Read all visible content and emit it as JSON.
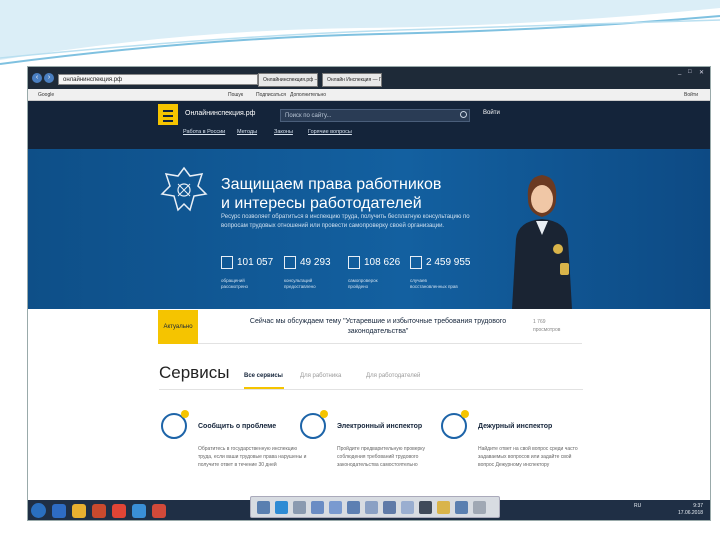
{
  "browser": {
    "address": "онлайнинспекция.рф",
    "tabs": [
      "Онлайнинспекция.рф — ...",
      "Онлайн Инспекция — Го..."
    ],
    "controls": {
      "min": "_",
      "max": "□",
      "close": "✕"
    },
    "bookmarks": {
      "search_engine": "Google",
      "items": [
        "Пошук",
        "Подписаться",
        "Дополнительно"
      ],
      "right": "Войти"
    }
  },
  "site": {
    "logo": "Онлайнинспекция.рф",
    "search_placeholder": "Поиск по сайту...",
    "login": "Войти",
    "subnav": [
      "Работа в России",
      "Методы",
      "Законы",
      "Горячие вопросы"
    ]
  },
  "hero": {
    "title_line1": "Защищаем права работников",
    "title_line2": "и интересы работодателей",
    "description": "Ресурс позволяет обратиться в инспекцию труда, получить бесплатную консультацию по вопросам трудовых отношений или провести самопроверку своей организации.",
    "stats": [
      {
        "icon": "mail-icon",
        "number": "101 057",
        "label1": "обращений",
        "label2": "рассмотрено"
      },
      {
        "icon": "calendar-icon",
        "number": "49 293",
        "label1": "консультаций",
        "label2": "предоставлено"
      },
      {
        "icon": "document-icon",
        "number": "108 626",
        "label1": "самопроверок",
        "label2": "пройдено"
      },
      {
        "icon": "gavel-icon",
        "number": "2 459 955",
        "label1": "случаев",
        "label2": "восстановленных прав"
      }
    ]
  },
  "actual": {
    "tag": "Актуально",
    "text": "Сейчас мы обсуждаем тему \"Устаревшие и избыточные требования трудового законодательства\"",
    "views": "1 769",
    "views_label": "просмотров"
  },
  "services": {
    "title": "Сервисы",
    "tabs": [
      "Все сервисы",
      "Для работника",
      "Для работодателей"
    ],
    "cards": [
      {
        "icon": "envelope-icon",
        "title": "Сообщить о проблеме",
        "desc": "Обратитесь в государственную инспекцию труда, если ваши трудовые права нарушены и получите ответ в течение 30 дней"
      },
      {
        "icon": "magnifier-icon",
        "title": "Электронный инспектор",
        "desc": "Пройдите предварительную проверку соблюдения требований трудового законодательства самостоятельно"
      },
      {
        "icon": "question-icon",
        "title": "Дежурный инспектор",
        "desc": "Найдите ответ на свой вопрос среди часто задаваемых вопросов или задайте свой вопрос Дежурному инспектору"
      }
    ]
  },
  "taskbar": {
    "lang": "RU",
    "time": "9:37",
    "date": "17.06.2018"
  },
  "colors": {
    "accent": "#f5c400",
    "header": "#14243a",
    "hero": "#1360a0"
  }
}
